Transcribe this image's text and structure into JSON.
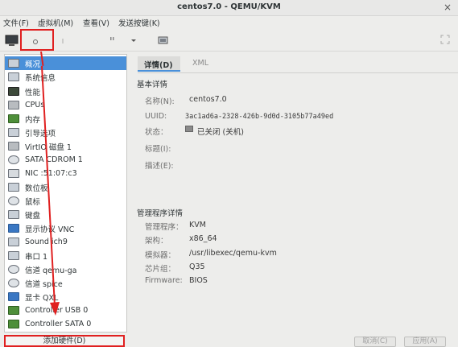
{
  "window": {
    "title": "centos7.0 - QEMU/KVM",
    "close_glyph": "×"
  },
  "menu": {
    "items": [
      "文件(F)",
      "虚拟机(M)",
      "查看(V)",
      "发送按键(K)"
    ]
  },
  "sidebar": {
    "items": [
      {
        "label": "概况",
        "icon": "overview-icon"
      },
      {
        "label": "系统信息",
        "icon": "sysinfo-icon"
      },
      {
        "label": "性能",
        "icon": "performance-icon"
      },
      {
        "label": "CPUs",
        "icon": "cpu-icon"
      },
      {
        "label": "内存",
        "icon": "memory-icon"
      },
      {
        "label": "引导选项",
        "icon": "boot-icon"
      },
      {
        "label": "VirtIO 磁盘 1",
        "icon": "disk-icon"
      },
      {
        "label": "SATA CDROM 1",
        "icon": "cdrom-icon"
      },
      {
        "label": "NIC :51:07:c3",
        "icon": "nic-icon"
      },
      {
        "label": "数位板",
        "icon": "tablet-icon"
      },
      {
        "label": "鼠标",
        "icon": "mouse-icon"
      },
      {
        "label": "键盘",
        "icon": "keyboard-icon"
      },
      {
        "label": "显示协议 VNC",
        "icon": "display-icon"
      },
      {
        "label": "Sound ich9",
        "icon": "sound-icon"
      },
      {
        "label": "串口 1",
        "icon": "serial-icon"
      },
      {
        "label": "信道 qemu-ga",
        "icon": "channel-icon"
      },
      {
        "label": "信道 spice",
        "icon": "channel-icon"
      },
      {
        "label": "显卡 QXL",
        "icon": "video-icon"
      },
      {
        "label": "Controller USB 0",
        "icon": "controller-icon"
      },
      {
        "label": "Controller SATA 0",
        "icon": "controller-icon"
      }
    ],
    "add_hardware_label": "添加硬件(D)"
  },
  "tabs": {
    "details": "详情(D)",
    "xml": "XML"
  },
  "basic": {
    "title": "基本详情",
    "name_label": "名称(N):",
    "name_value": "centos7.0",
    "uuid_label": "UUID:",
    "uuid_value": "3ac1ad6a-2328-426b-9d0d-3105b77a49ed",
    "status_label": "状态：",
    "status_value": "已关闭 (关机)",
    "title_label": "标题(I):",
    "desc_label": "描述(E):"
  },
  "hypervisor": {
    "title": "管理程序详情",
    "hv_label": "管理程序：",
    "hv_value": "KVM",
    "arch_label": "架构：",
    "arch_value": "x86_64",
    "emu_label": "模拟器：",
    "emu_value": "/usr/libexec/qemu-kvm",
    "chip_label": "芯片组：",
    "chip_value": "Q35",
    "fw_label": "Firmware:",
    "fw_value": "BIOS"
  },
  "buttons": {
    "cancel": "取消(C)",
    "apply": "应用(A)"
  },
  "colors": {
    "accent": "#4a90d9",
    "annotation": "#e02020"
  }
}
